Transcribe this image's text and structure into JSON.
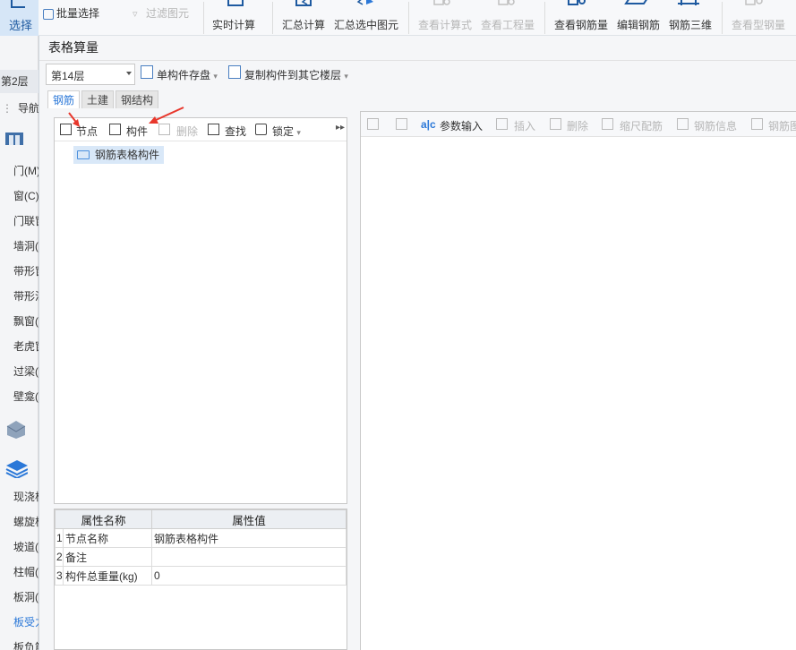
{
  "ribbon": {
    "select_label": "选择",
    "batch_select": "批量选择",
    "filter_element": "过滤图元",
    "realtime_calc": "实时计算",
    "summary_calc": "汇总计算",
    "summary_selected": "汇总选中图元",
    "view_formula": "查看计算式",
    "view_quantity": "查看工程量",
    "view_rebar_amount": "查看钢筋量",
    "edit_rebar": "编辑钢筋",
    "rebar_3d": "钢筋三维",
    "view_steel_amount": "查看型钢量"
  },
  "nav": {
    "floor_tab": "第2层",
    "header": "导航",
    "items": [
      "门(M)",
      "窗(C)",
      "门联窗",
      "墙洞(D)",
      "带形窗",
      "带形洞",
      "飘窗(",
      "老虎窗",
      "过梁(",
      "壁龛(",
      "现浇板",
      "螺旋板",
      "坡道(",
      "柱帽(",
      "板洞(",
      "板受力",
      "板负筋"
    ]
  },
  "dialog": {
    "title": "表格算量",
    "floor": "第14层",
    "save_single": "单构件存盘",
    "copy_to_floors": "复制构件到其它楼层",
    "tabs": [
      "钢筋",
      "土建",
      "钢结构"
    ]
  },
  "left_toolbar": {
    "node": "节点",
    "component": "构件",
    "delete": "删除",
    "find": "查找",
    "lock": "锁定"
  },
  "tree": {
    "root": "钢筋表格构件"
  },
  "props": {
    "col_name": "属性名称",
    "col_value": "属性值",
    "rows": [
      {
        "idx": "1",
        "name": "节点名称",
        "value": "钢筋表格构件"
      },
      {
        "idx": "2",
        "name": "备注",
        "value": ""
      },
      {
        "idx": "3",
        "name": "构件总重量(kg)",
        "value": "0"
      }
    ]
  },
  "right_toolbar": {
    "param_input": "参数输入",
    "insert": "插入",
    "delete": "删除",
    "scale_rebar": "缩尺配筋",
    "rebar_info": "钢筋信息",
    "rebar_diagram": "钢筋图"
  },
  "colors": {
    "accent": "#2b78d8",
    "arrow": "#e8372c"
  }
}
